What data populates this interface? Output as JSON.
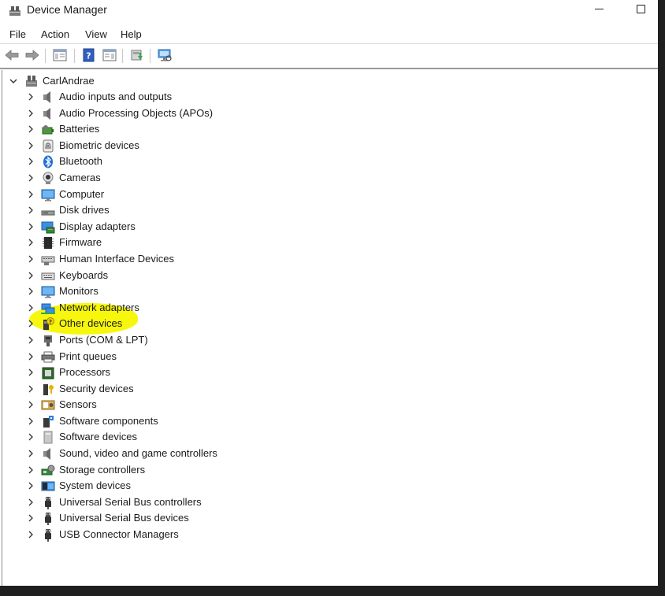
{
  "window": {
    "title": "Device Manager",
    "title_icon": "device-manager-icon"
  },
  "menu": {
    "items": [
      "File",
      "Action",
      "View",
      "Help"
    ]
  },
  "toolbar": {
    "buttons": [
      "back-arrow-icon",
      "forward-arrow-icon",
      "show-hide-console-tree-icon",
      "help-icon",
      "properties-pane-icon",
      "update-driver-icon",
      "scan-hardware-icon"
    ]
  },
  "tree": {
    "root": {
      "label": "CarlAndrae",
      "icon": "computer-tower-icon",
      "expanded": true
    },
    "categories": [
      {
        "label": "Audio inputs and outputs",
        "icon": "speaker-icon"
      },
      {
        "label": "Audio Processing Objects (APOs)",
        "icon": "speaker-icon"
      },
      {
        "label": "Batteries",
        "icon": "battery-icon"
      },
      {
        "label": "Biometric devices",
        "icon": "fingerprint-icon"
      },
      {
        "label": "Bluetooth",
        "icon": "bluetooth-icon"
      },
      {
        "label": "Cameras",
        "icon": "webcam-icon"
      },
      {
        "label": "Computer",
        "icon": "monitor-icon"
      },
      {
        "label": "Disk drives",
        "icon": "disk-drive-icon"
      },
      {
        "label": "Display adapters",
        "icon": "display-adapter-icon"
      },
      {
        "label": "Firmware",
        "icon": "firmware-chip-icon"
      },
      {
        "label": "Human Interface Devices",
        "icon": "hid-keyboard-icon"
      },
      {
        "label": "Keyboards",
        "icon": "keyboard-icon"
      },
      {
        "label": "Monitors",
        "icon": "monitor-icon"
      },
      {
        "label": "Network adapters",
        "icon": "network-icon"
      },
      {
        "label": "Other devices",
        "icon": "unknown-device-icon",
        "highlighted": true
      },
      {
        "label": "Ports (COM & LPT)",
        "icon": "port-icon"
      },
      {
        "label": "Print queues",
        "icon": "printer-icon"
      },
      {
        "label": "Processors",
        "icon": "processor-icon"
      },
      {
        "label": "Security devices",
        "icon": "security-key-icon"
      },
      {
        "label": "Sensors",
        "icon": "sensor-icon"
      },
      {
        "label": "Software components",
        "icon": "software-component-icon"
      },
      {
        "label": "Software devices",
        "icon": "software-device-icon"
      },
      {
        "label": "Sound, video and game controllers",
        "icon": "speaker-icon"
      },
      {
        "label": "Storage controllers",
        "icon": "storage-controller-icon"
      },
      {
        "label": "System devices",
        "icon": "system-devices-icon"
      },
      {
        "label": "Universal Serial Bus controllers",
        "icon": "usb-icon"
      },
      {
        "label": "Universal Serial Bus devices",
        "icon": "usb-icon"
      },
      {
        "label": "USB Connector Managers",
        "icon": "usb-icon"
      }
    ]
  },
  "colors": {
    "highlight": "#f7f700",
    "bluetooth": "#1e6fd9",
    "monitor_blue": "#3a8ee6"
  }
}
